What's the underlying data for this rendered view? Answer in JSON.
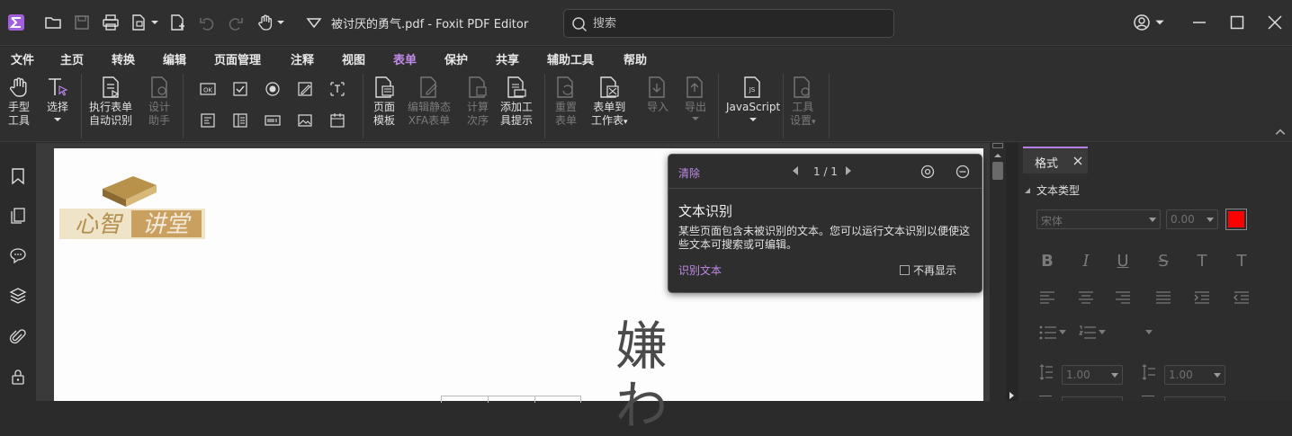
{
  "titlebar": {
    "document_title": "被讨厌的勇气.pdf - Foxit PDF Editor",
    "search_placeholder": "搜索"
  },
  "menu": {
    "items": [
      "文件",
      "主页",
      "转换",
      "编辑",
      "页面管理",
      "注释",
      "视图",
      "表单",
      "保护",
      "共享",
      "辅助工具",
      "帮助"
    ],
    "active": "表单"
  },
  "ribbon": {
    "hand": [
      "手型",
      "工具"
    ],
    "select": "选择",
    "run_form": [
      "执行表单",
      "自动识别"
    ],
    "design": [
      "设计",
      "助手"
    ],
    "page_template": [
      "页面",
      "模板"
    ],
    "edit_xfa": [
      "编辑静态",
      "XFA表单"
    ],
    "calc_order": [
      "计算",
      "次序"
    ],
    "add_tooltip": [
      "添加工",
      "具提示"
    ],
    "reset_form": [
      "重置",
      "表单"
    ],
    "form_to_sheet": [
      "表单到",
      "工作表"
    ],
    "import": "导入",
    "export": "导出",
    "javascript": "JavaScript",
    "tool_settings": [
      "工具",
      "设置"
    ],
    "ok_label": "OK"
  },
  "popup": {
    "clear": "清除",
    "page_counter": "1 / 1",
    "title": "文本识别",
    "body": "某些页面包含未被识别的文本。您可以运行文本识别以便使这些文本可搜索或可编辑。",
    "action_link": "识别文本",
    "dont_show": "不再显示"
  },
  "document": {
    "logo_text": "心智讲堂",
    "vertical_char_1": "嫌",
    "vertical_char_2": "わ"
  },
  "right_panel": {
    "tab": "格式",
    "section": "文本类型",
    "font": "宋体",
    "font_size": "0.00",
    "line_spacing": "1.00",
    "char_spacing": "1.00",
    "text_color": "#ff0000",
    "style_buttons": [
      "B",
      "I",
      "U",
      "S",
      "T",
      "T"
    ]
  },
  "colors": {
    "accent": "#b57fe6",
    "background": "#2b2b2b"
  }
}
